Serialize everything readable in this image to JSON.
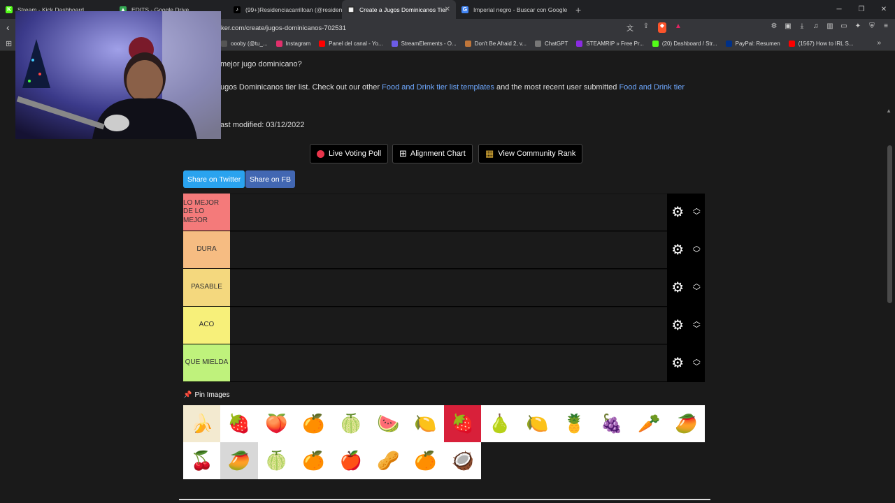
{
  "tabs": [
    {
      "title": "Stream - Kick Dashboard",
      "fav_color": "#53fc18",
      "fav_glyph": "K"
    },
    {
      "title": "EDITS - Google Drive",
      "fav_color": "#34a853",
      "fav_glyph": "▲"
    },
    {
      "title": "(99+)Residenciacarrilloan (@residenc",
      "fav_color": "#000000",
      "fav_glyph": "♪"
    },
    {
      "title": "Create a Jugos Dominicanos Tier",
      "fav_color": "#2b2b2b",
      "fav_glyph": "▦"
    },
    {
      "title": "Imperial negro - Buscar con Google",
      "fav_color": "#4285f4",
      "fav_glyph": "G"
    }
  ],
  "active_tab": 3,
  "address_url": "ker.com/create/jugos-dominicanos-702531",
  "bookmarks": [
    {
      "label": "oooby (@tu_...",
      "color": "#555"
    },
    {
      "label": "Instagram",
      "color": "#e1306c"
    },
    {
      "label": "Panel del canal - Yo...",
      "color": "#ff0000"
    },
    {
      "label": "StreamElements - O...",
      "color": "#6c5ce7"
    },
    {
      "label": "Don't Be Afraid 2, v...",
      "color": "#c0763a"
    },
    {
      "label": "ChatGPT",
      "color": "#777"
    },
    {
      "label": "STEAMRIP » Free Pr...",
      "color": "#8a2be2"
    },
    {
      "label": "(20) Dashboard / Str...",
      "color": "#53fc18"
    },
    {
      "label": "PayPal: Resumen",
      "color": "#003087"
    },
    {
      "label": "(1567) How to IRL S...",
      "color": "#ff0000"
    }
  ],
  "page": {
    "question": "mejor jugo dominicano?",
    "desc_prefix": "ugos Dominicanos tier list. Check out our other ",
    "desc_link1": "Food and Drink tier list templates",
    "desc_mid": " and the most recent user submitted ",
    "desc_link2": "Food and Drink tier",
    "last_modified": "ast modified: 03/12/2022",
    "btn_poll": "Live Voting Poll",
    "btn_align": "Alignment Chart",
    "btn_rank": "View Community Rank",
    "share_twitter": "Share on Twitter",
    "share_fb": "Share on FB",
    "pin_images": "Pin Images"
  },
  "tiers": [
    {
      "label": "LO MEJOR DE LO MEJOR",
      "color": "#f47a7a"
    },
    {
      "label": "DURA",
      "color": "#f6bc82"
    },
    {
      "label": "PASABLE",
      "color": "#f4d87e"
    },
    {
      "label": "ACO",
      "color": "#f7f07a"
    },
    {
      "label": "QUE MIELDA",
      "color": "#bff27c"
    }
  ],
  "fruits": [
    {
      "name": "banana",
      "glyph": "🍌",
      "bg": "#f3ead0"
    },
    {
      "name": "strawberry",
      "glyph": "🍓",
      "bg": "#ffffff"
    },
    {
      "name": "peach",
      "glyph": "🍑",
      "bg": "#ffffff"
    },
    {
      "name": "orange",
      "glyph": "🍊",
      "bg": "#ffffff"
    },
    {
      "name": "soursop",
      "glyph": "🍈",
      "bg": "#ffffff"
    },
    {
      "name": "watermelon",
      "glyph": "🍉",
      "bg": "#ffffff"
    },
    {
      "name": "lime",
      "glyph": "🍋",
      "bg": "#ffffff"
    },
    {
      "name": "raspberry",
      "glyph": "🍓",
      "bg": "#d8203a"
    },
    {
      "name": "guava",
      "glyph": "🍐",
      "bg": "#ffffff"
    },
    {
      "name": "passion fruit",
      "glyph": "🍋",
      "bg": "#ffffff"
    },
    {
      "name": "pineapple",
      "glyph": "🍍",
      "bg": "#ffffff"
    },
    {
      "name": "grapes",
      "glyph": "🍇",
      "bg": "#ffffff"
    },
    {
      "name": "carrot",
      "glyph": "🥕",
      "bg": "#ffffff"
    },
    {
      "name": "papaya",
      "glyph": "🥭",
      "bg": "#ffffff"
    },
    {
      "name": "cherry",
      "glyph": "🍒",
      "bg": "#ffffff"
    },
    {
      "name": "mango",
      "glyph": "🥭",
      "bg": "#d8d8d8"
    },
    {
      "name": "cantaloupe",
      "glyph": "🍈",
      "bg": "#ffffff"
    },
    {
      "name": "orange slices",
      "glyph": "🍊",
      "bg": "#ffffff"
    },
    {
      "name": "apple",
      "glyph": "🍎",
      "bg": "#ffffff"
    },
    {
      "name": "tamarind",
      "glyph": "🥜",
      "bg": "#ffffff"
    },
    {
      "name": "grapefruit",
      "glyph": "🍊",
      "bg": "#ffffff"
    },
    {
      "name": "mamey",
      "glyph": "🥥",
      "bg": "#ffffff"
    }
  ]
}
